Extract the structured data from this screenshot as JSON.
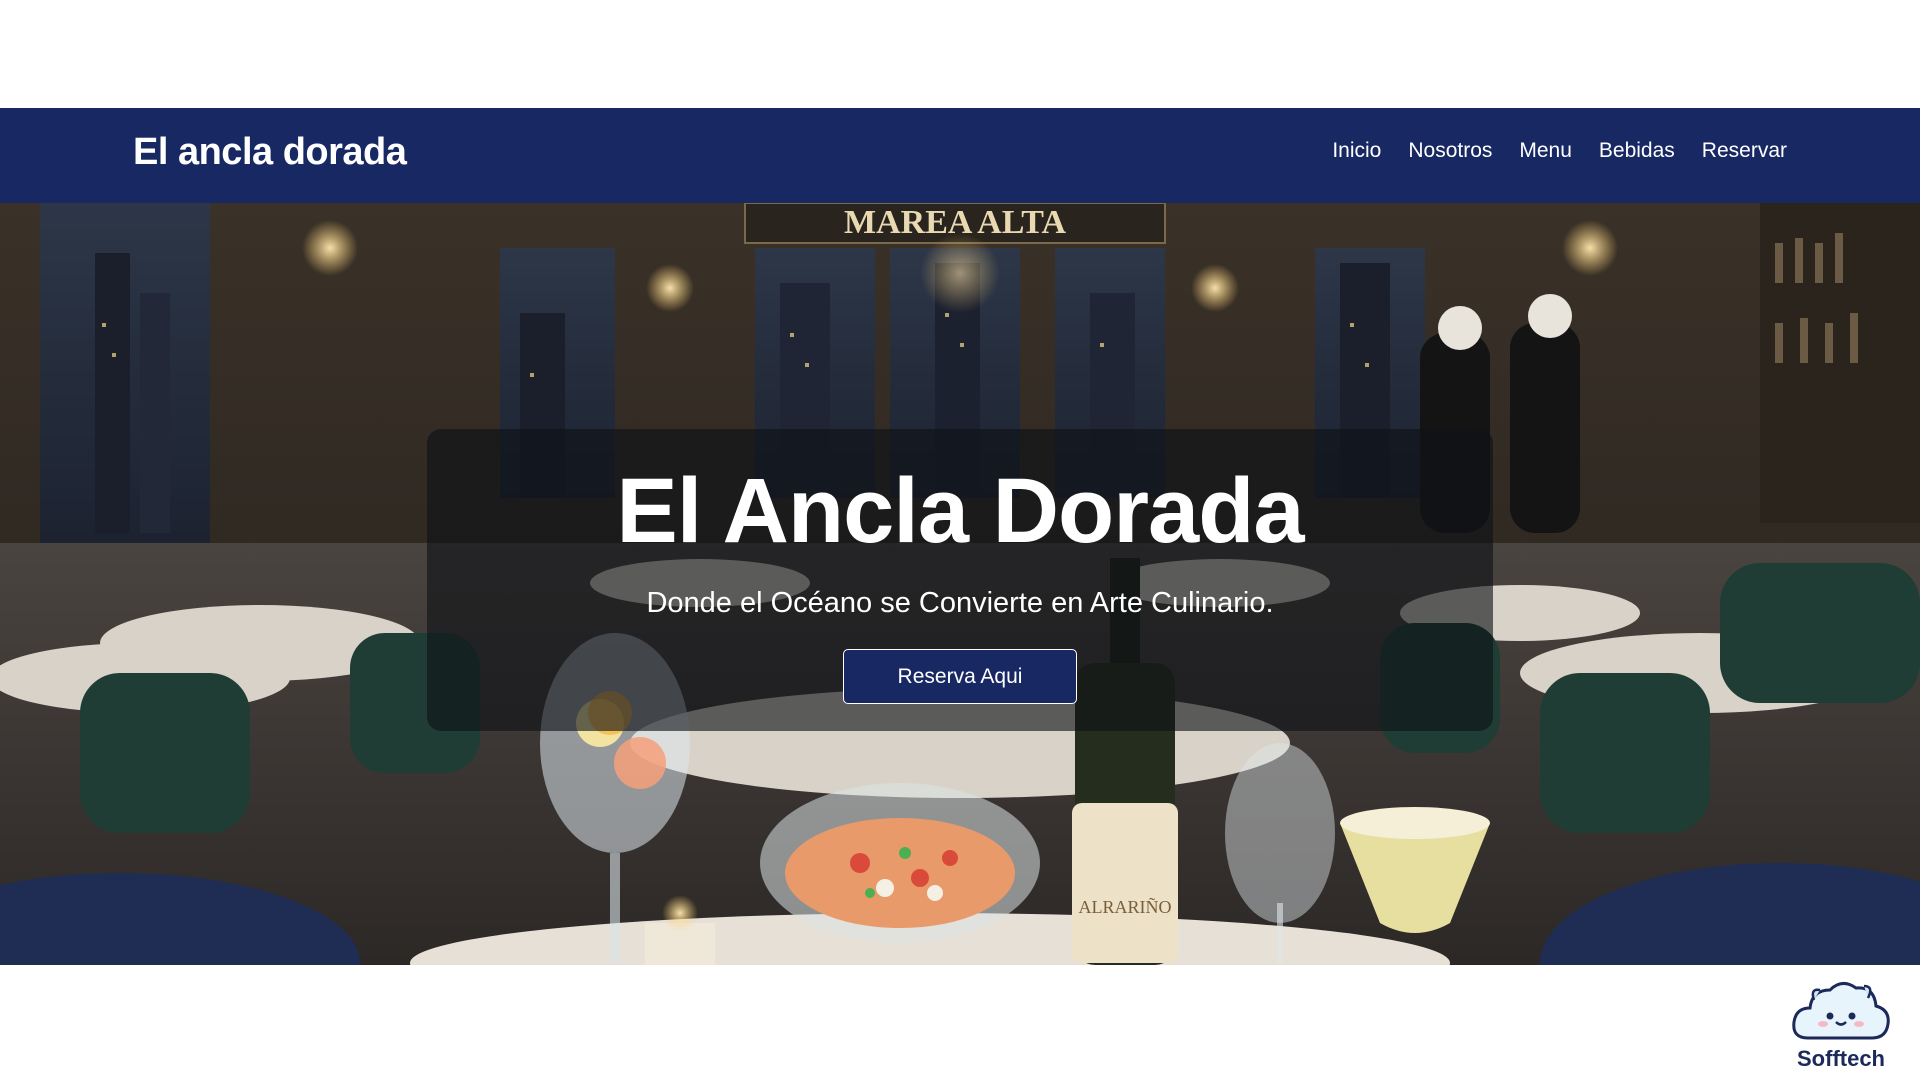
{
  "navbar": {
    "brand": "El ancla dorada",
    "links": [
      {
        "label": "Inicio"
      },
      {
        "label": "Nosotros"
      },
      {
        "label": "Menu"
      },
      {
        "label": "Bebidas"
      },
      {
        "label": "Reservar"
      }
    ]
  },
  "hero": {
    "background_sign": "MAREA ALTA",
    "bottle_label": "ALRARIÑO",
    "title": "El Ancla Dorada",
    "subtitle": "Donde el Océano se Convierte en Arte Culinario.",
    "cta_label": "Reserva Aqui"
  },
  "watermark": {
    "name": "Sofftech",
    "icon": "cloud-mascot-icon"
  },
  "colors": {
    "navbar_bg": "#182863",
    "button_bg": "#182863",
    "text_light": "#ffffff",
    "logo_text": "#1b2a5a"
  }
}
